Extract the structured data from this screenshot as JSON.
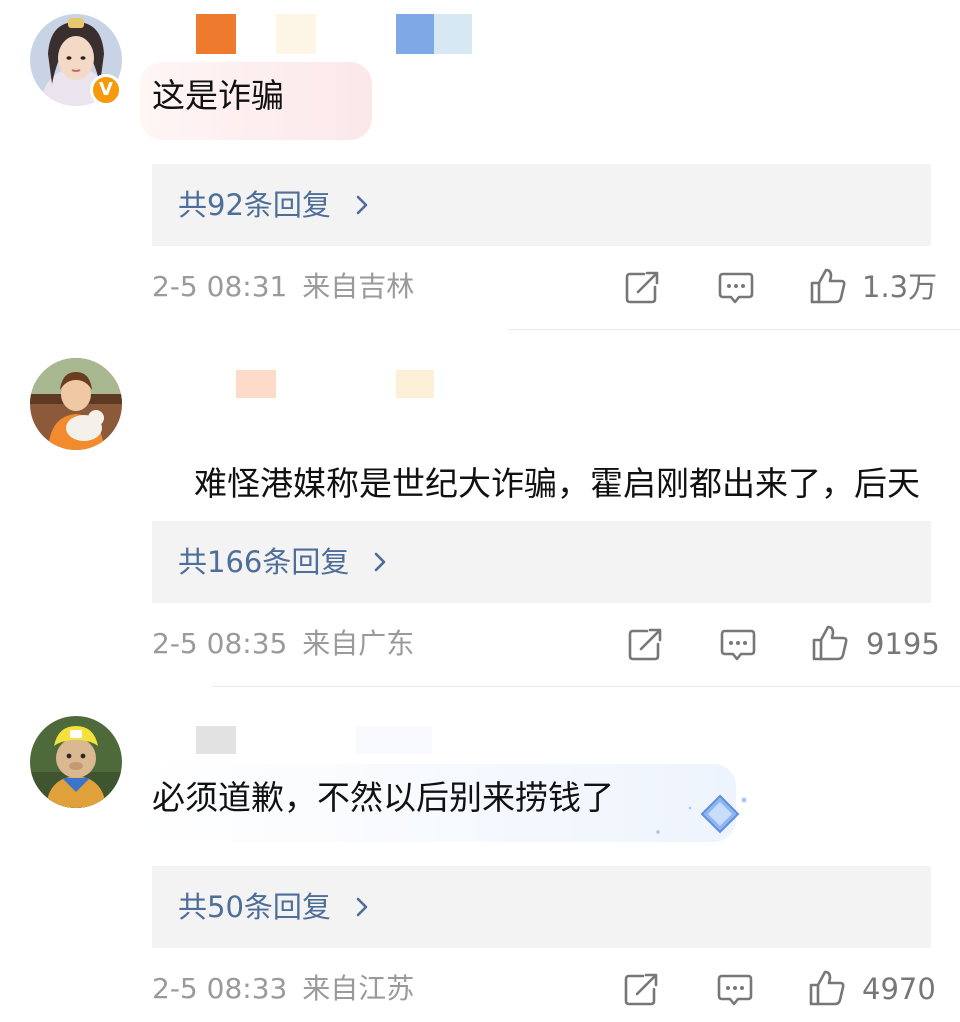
{
  "colors": {
    "reply_link": "#4d6e99",
    "reply_bg": "#f3f3f3",
    "meta_text": "#9a9a9a",
    "verified_badge": "#f59a0b"
  },
  "comments": [
    {
      "text": "这是诈骗",
      "replies": "共92条回复",
      "time": "2-5 08:31",
      "location": "来自吉林",
      "likes": "1.3万",
      "verified_badge": "V",
      "icons": [
        "share-icon",
        "comment-icon",
        "like-icon",
        "chevron-right-icon"
      ]
    },
    {
      "text": "难怪港媒称是世纪大诈骗，霍启刚都出来了，后天在日本的友谊赛，可能就伤好了",
      "emoji": "doge-emoji-icon",
      "replies": "共166条回复",
      "time": "2-5 08:35",
      "location": "来自广东",
      "likes": "9195",
      "icons": [
        "share-icon",
        "comment-icon",
        "like-icon",
        "chevron-right-icon"
      ]
    },
    {
      "text": "必须道歉，不然以后别来捞钱了",
      "replies": "共50条回复",
      "time": "2-5 08:33",
      "location": "来自江苏",
      "likes": "4970",
      "icons": [
        "share-icon",
        "comment-icon",
        "like-icon",
        "chevron-right-icon",
        "diamond-sticker-icon"
      ]
    }
  ]
}
